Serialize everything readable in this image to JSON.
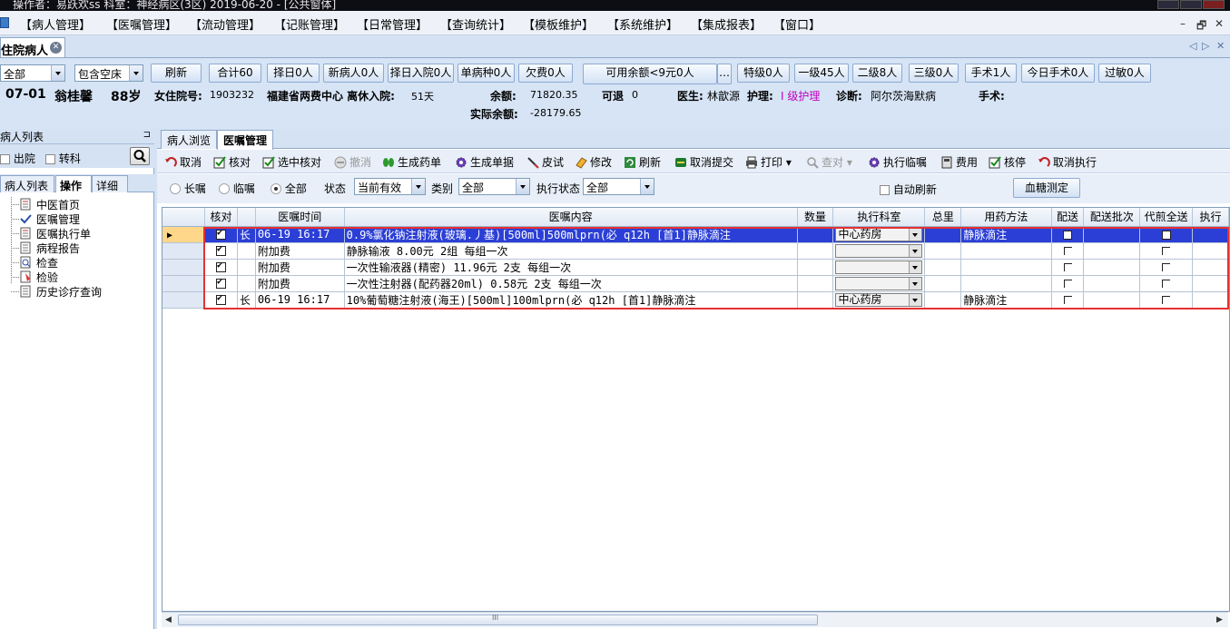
{
  "window": {
    "title": "操作者：易跃欢ss  科室：神经病区(3区)  2019-06-20 - [公共窗体]"
  },
  "menu": {
    "items": [
      "【病人管理】",
      "【医嘱管理】",
      "【流动管理】",
      "【记账管理】",
      "【日常管理】",
      "【查询统计】",
      "【模板维护】",
      "【系统维护】",
      "【集成报表】",
      "【窗口】"
    ],
    "mdi": [
      "–",
      "🗗",
      "✕"
    ]
  },
  "doc_tab": {
    "label": "住院病人",
    "close": "✕",
    "nav_prev": "◁",
    "nav_next": "▷",
    "nav_close": "✕"
  },
  "filters": {
    "ward": "全部",
    "bed_filter": "包含空床",
    "buttons": [
      "刷新",
      "合计60",
      "择日0人",
      "新病人0人",
      "择日入院0人",
      "单病种0人",
      "欠费0人"
    ],
    "balance_btn": "可用余额<9元0人",
    "balance_more": "…",
    "level_buttons": [
      "特级0人",
      "一级45人",
      "二级8人",
      "三级0人",
      "手术1人",
      "今日手术0人",
      "过敏0人"
    ]
  },
  "patient": {
    "bed": "07-01",
    "name": "翁桂馨",
    "age": "88岁",
    "gender_inpatient_label": "女住院号:",
    "inpatient_no": "1903232",
    "insurance": "福建省两费中心 离休入院:",
    "days": "51天",
    "balance_label": "余额:",
    "balance": "71820.35",
    "refund_label": "可退",
    "refund": "0",
    "doctor_label": "医生:",
    "doctor": "林歆源",
    "nursing_label": "护理:",
    "nursing": "I 级护理",
    "diagnosis_label": "诊断:",
    "diagnosis": "阿尔茨海默病",
    "surgery_label": "手术:",
    "actual_balance_label": "实际余额:",
    "actual_balance": "-28179.65"
  },
  "left": {
    "header": "病人列表",
    "pin": "⊐",
    "discharged": "出院",
    "transfer": "转科",
    "tabs": [
      "病人列表",
      "操作",
      "详细"
    ],
    "tree": [
      "中医首页",
      "医嘱管理",
      "医嘱执行单",
      "病程报告",
      "检查",
      "检验",
      "历史诊疗查询"
    ]
  },
  "main_tabs": [
    "病人浏览",
    "医嘱管理"
  ],
  "actions": [
    "取消",
    "核对",
    "选中核对",
    "撤消",
    "生成药单",
    "生成单据",
    "皮试",
    "修改",
    "刷新",
    "取消提交",
    "打印",
    "查对",
    "执行临嘱",
    "费用",
    "核停",
    "取消执行"
  ],
  "order_filter": {
    "long_term": "长嘱",
    "temporary": "临嘱",
    "all": "全部",
    "status_label": "状态",
    "status_value": "当前有效",
    "category_label": "类别",
    "category_value": "全部",
    "exec_status_label": "执行状态",
    "exec_status_value": "全部",
    "auto_refresh": "自动刷新",
    "blood_sugar": "血糖测定"
  },
  "grid": {
    "columns": [
      "核对",
      "医嘱时间",
      "医嘱内容",
      "数量",
      "执行科室",
      "总里",
      "用药方法",
      "配送",
      "配送批次",
      "代煎全送",
      "执行"
    ],
    "rows": [
      {
        "type": "长",
        "time": "06-19 16:17",
        "content": "0.9%氯化钠注射液(玻璃.丿基)[500ml]500mlprn(必   q12h [首1]静脉滴注",
        "dept": "中心药房",
        "method": "静脉滴注"
      },
      {
        "type": "",
        "time": "附加费",
        "content": "静脉输液    8.00元 2组          每组一次",
        "dept": "",
        "method": ""
      },
      {
        "type": "",
        "time": "附加费",
        "content": "一次性输液器(精密)    11.96元 2支  每组一次",
        "dept": "",
        "method": ""
      },
      {
        "type": "",
        "time": "附加费",
        "content": "一次性注射器(配药器20ml)    0.58元 2支  每组一次",
        "dept": "",
        "method": ""
      },
      {
        "type": "长",
        "time": "06-19 16:17",
        "content": "10%葡萄糖注射液(海王)[500ml]100mlprn(必        q12h [首1]静脉滴注",
        "dept": "中心药房",
        "method": "静脉滴注"
      }
    ],
    "selected_marker": "▶"
  },
  "scroll": {
    "mark": "III"
  },
  "colors": {
    "selected_row": "#2b3fd6",
    "highlight_box": "#e53030",
    "nursing": "#c000c0"
  }
}
